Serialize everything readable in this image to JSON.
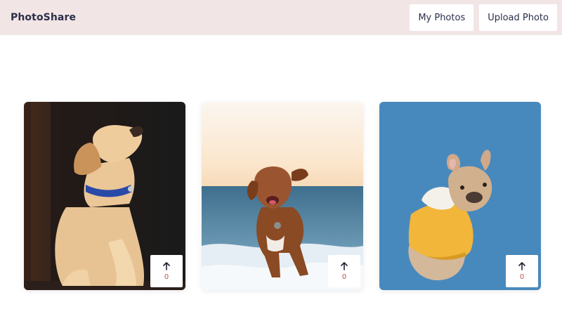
{
  "navbar": {
    "brand": "PhotoShare",
    "my_photos_label": "My Photos",
    "upload_label": "Upload Photo"
  },
  "photos": [
    {
      "subject": "labrador puppy looking up",
      "vote_count": "0"
    },
    {
      "subject": "dog running in the surf",
      "vote_count": "0"
    },
    {
      "subject": "french bulldog in yellow hoodie",
      "vote_count": "0"
    }
  ],
  "icons": {
    "vote": "arrow-up-icon"
  },
  "colors": {
    "navbar_bg": "#f2e5e6",
    "brand_text": "#2b2f4a",
    "vote_count": "#c0504d"
  }
}
